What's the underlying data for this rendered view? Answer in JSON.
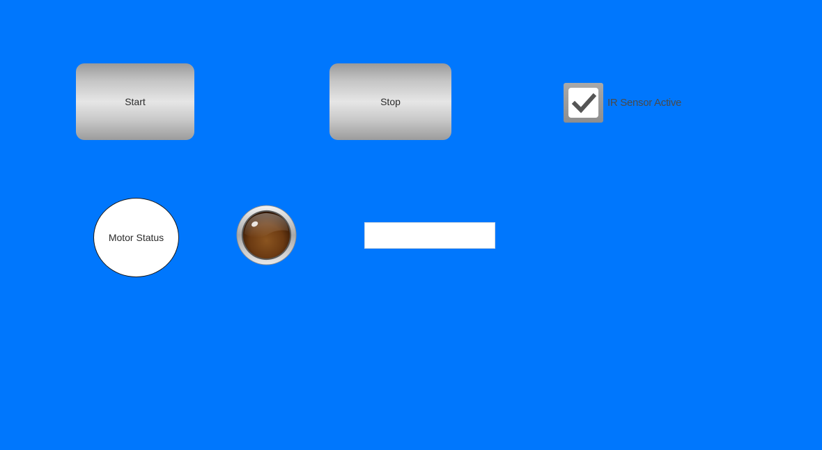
{
  "controls": {
    "start_label": "Start",
    "stop_label": "Stop",
    "ir_sensor_label": "IR Sensor Active",
    "ir_sensor_checked": true
  },
  "motor": {
    "status_label": "Motor Status",
    "lamp_state": "off"
  },
  "value_field": {
    "value": ""
  },
  "colors": {
    "background": "#0077fd",
    "button_face": "#e6e6e6",
    "lamp_off": "#6b3a12",
    "checkmark": "#555555"
  },
  "icons": {
    "checkbox": "checkmark-icon",
    "lamp": "indicator-lamp-icon"
  }
}
